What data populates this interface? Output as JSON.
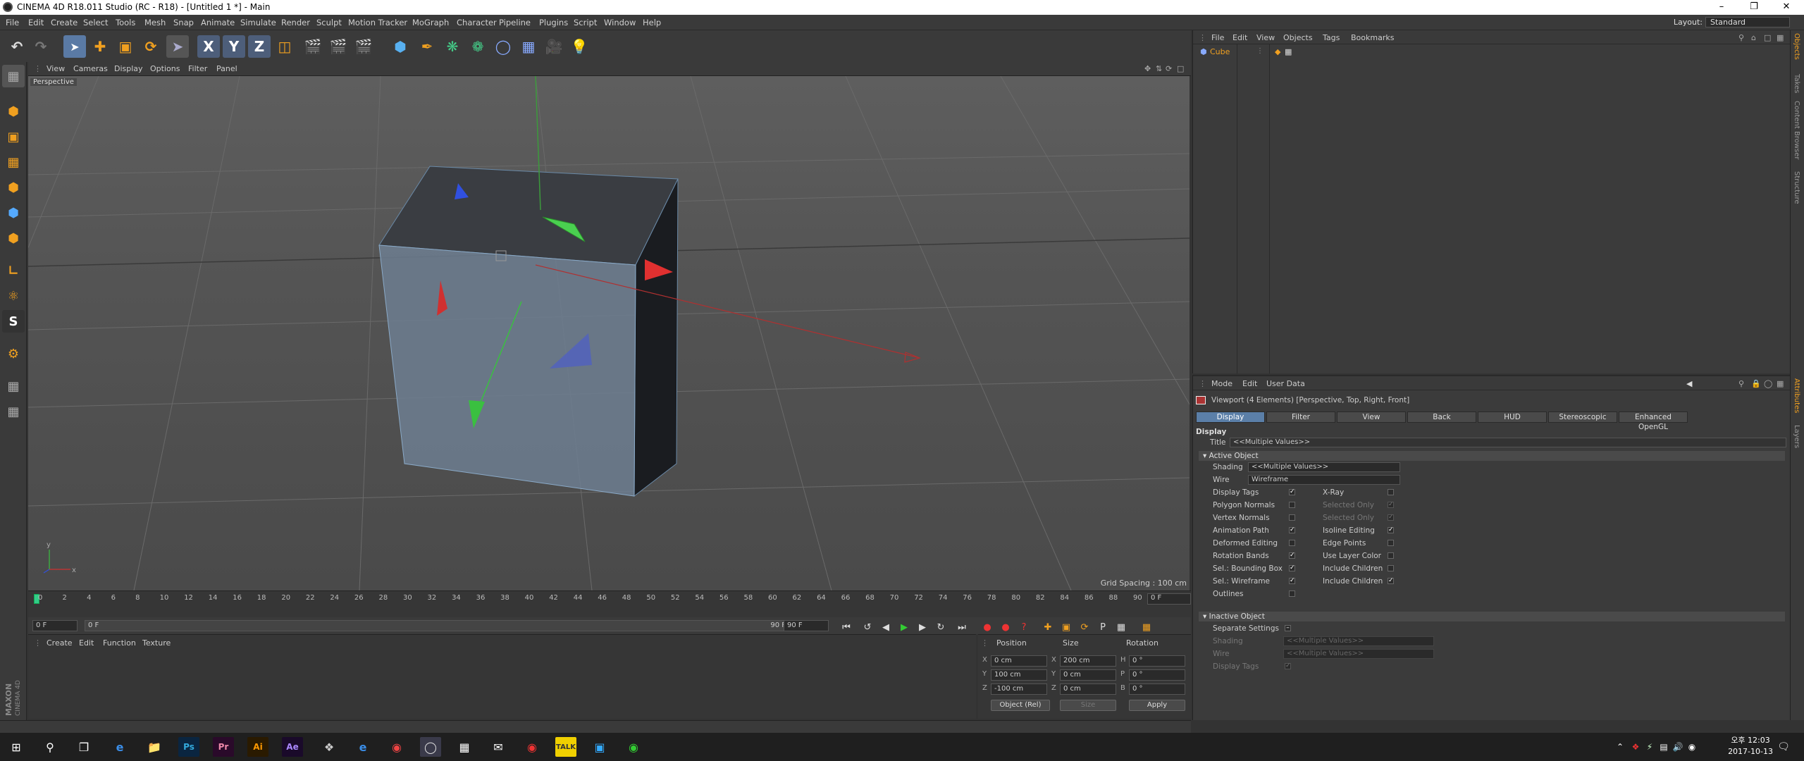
{
  "window": {
    "title": "CINEMA 4D R18.011 Studio (RC - R18) - [Untitled 1 *] - Main"
  },
  "menubar": {
    "items": [
      "File",
      "Edit",
      "Create",
      "Select",
      "Tools",
      "Mesh",
      "Snap",
      "Animate",
      "Simulate",
      "Render",
      "Sculpt",
      "Motion Tracker",
      "MoGraph",
      "Character",
      "Pipeline",
      "Plugins",
      "Script",
      "Window",
      "Help"
    ],
    "layout_label": "Layout:",
    "layout_value": "Standard"
  },
  "viewport": {
    "menu": [
      "View",
      "Cameras",
      "Display",
      "Options",
      "Filter",
      "Panel"
    ],
    "label": "Perspective",
    "grid_spacing": "Grid Spacing : 100 cm"
  },
  "timeline": {
    "ticks": [
      "0",
      "2",
      "4",
      "6",
      "8",
      "10",
      "12",
      "14",
      "16",
      "18",
      "20",
      "22",
      "24",
      "26",
      "28",
      "30",
      "32",
      "34",
      "36",
      "38",
      "40",
      "42",
      "44",
      "46",
      "48",
      "50",
      "52",
      "54",
      "56",
      "58",
      "60",
      "62",
      "64",
      "66",
      "68",
      "70",
      "72",
      "74",
      "76",
      "78",
      "80",
      "82",
      "84",
      "86",
      "88",
      "90"
    ],
    "current": "0 F",
    "start": "0 F",
    "range_left": "0 F",
    "range_right": "90 F",
    "end": "90 F"
  },
  "materials": {
    "menu": [
      "Create",
      "Edit",
      "Function",
      "Texture"
    ]
  },
  "coords": {
    "headers": [
      "Position",
      "Size",
      "Rotation"
    ],
    "pos": [
      "0 cm",
      "100 cm",
      "-100 cm"
    ],
    "size": [
      "200 cm",
      "0 cm",
      "0 cm"
    ],
    "rot": [
      "0 °",
      "0 °",
      "0 °"
    ],
    "axes": [
      "X",
      "Y",
      "Z"
    ],
    "rot_axes": [
      "H",
      "P",
      "B"
    ],
    "mode": "Object (Rel)",
    "size_mode": "Size",
    "apply": "Apply"
  },
  "objects": {
    "menu": [
      "File",
      "Edit",
      "View",
      "Objects",
      "Tags",
      "Bookmarks"
    ],
    "items": [
      {
        "name": "Cube"
      }
    ]
  },
  "attributes": {
    "menu": [
      "Mode",
      "Edit",
      "User Data"
    ],
    "header": "Viewport (4 Elements) [Perspective, Top, Right, Front]",
    "tabs": [
      "Display",
      "Filter",
      "View",
      "Back",
      "HUD",
      "Stereoscopic",
      "Enhanced OpenGL"
    ],
    "section": "Display",
    "title_label": "Title",
    "title_value": "<<Multiple Values>>",
    "active_object": "Active Object",
    "shading_label": "Shading",
    "shading_value": "<<Multiple Values>>",
    "wire_label": "Wire",
    "wire_value": "Wireframe",
    "left_opts": [
      {
        "label": "Display Tags",
        "checked": "✓"
      },
      {
        "label": "Polygon Normals",
        "checked": ""
      },
      {
        "label": "Vertex Normals",
        "checked": ""
      },
      {
        "label": "Animation Path",
        "checked": "✓"
      },
      {
        "label": "Deformed Editing",
        "checked": ""
      },
      {
        "label": "Rotation Bands",
        "checked": "✓"
      },
      {
        "label": "Sel.: Bounding Box",
        "checked": "✓"
      },
      {
        "label": "Sel.: Wireframe",
        "checked": "✓"
      },
      {
        "label": "Outlines",
        "checked": ""
      }
    ],
    "right_opts": [
      {
        "label": "X-Ray",
        "checked": ""
      },
      {
        "label": "Selected Only",
        "checked": "✓"
      },
      {
        "label": "Selected Only",
        "checked": "✓"
      },
      {
        "label": "Isoline Editing",
        "checked": "✓"
      },
      {
        "label": "Edge Points",
        "checked": ""
      },
      {
        "label": "Use Layer Color",
        "checked": ""
      },
      {
        "label": "Include Children",
        "checked": ""
      },
      {
        "label": "Include Children",
        "checked": "✓"
      }
    ],
    "inactive_object": "Inactive Object",
    "separate_settings": "Separate Settings",
    "inactive_shading": "Shading",
    "inactive_wire": "Wire",
    "inactive_display_tags": "Display Tags",
    "multiple": "<<Multiple Values>>"
  },
  "rightstrip": [
    "Objects",
    "Takes",
    "Content Browser",
    "Structure",
    "Attributes",
    "Layers"
  ],
  "taskbar": {
    "time": "오후 12:03",
    "date": "2017-10-13"
  }
}
